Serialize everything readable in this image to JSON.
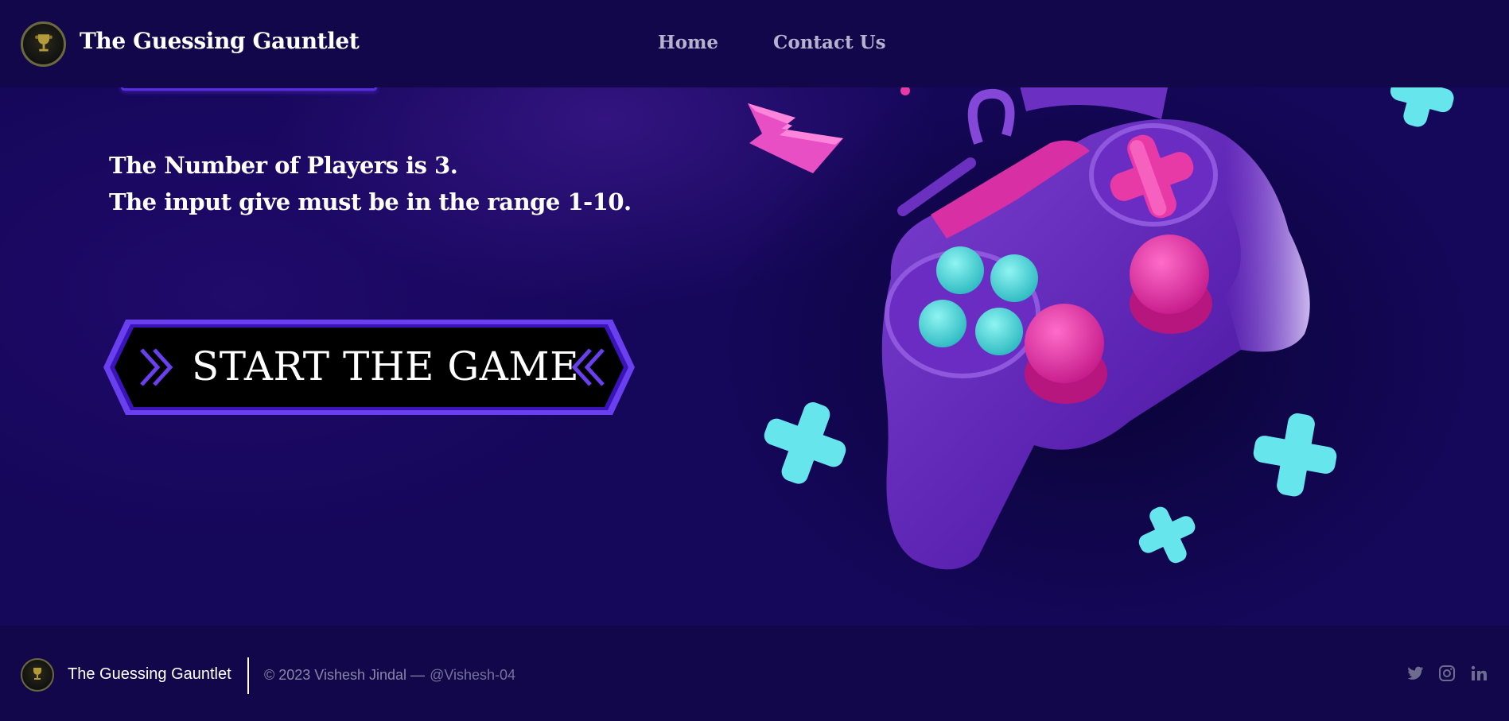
{
  "brand": {
    "title": "The Guessing Gauntlet",
    "logo_icon": "trophy-icon"
  },
  "nav": {
    "items": [
      {
        "label": "Home"
      },
      {
        "label": "Contact Us"
      }
    ]
  },
  "hero": {
    "info_lines": [
      "The Number of Players is 3.",
      "The input give must be in the range 1-10."
    ],
    "start_button_label": "START THE GAME",
    "art": "gamepad-illustration"
  },
  "footer": {
    "title": "The Guessing Gauntlet",
    "copyright": "© 2023 Vishesh Jindal —",
    "handle": "@Vishesh-04",
    "socials": [
      "twitter-icon",
      "instagram-icon",
      "linkedin-icon"
    ]
  },
  "colors": {
    "background": "#10064a",
    "accent": "#5a2de0",
    "pink": "#e83aa7",
    "cyan": "#5fe3e3"
  }
}
